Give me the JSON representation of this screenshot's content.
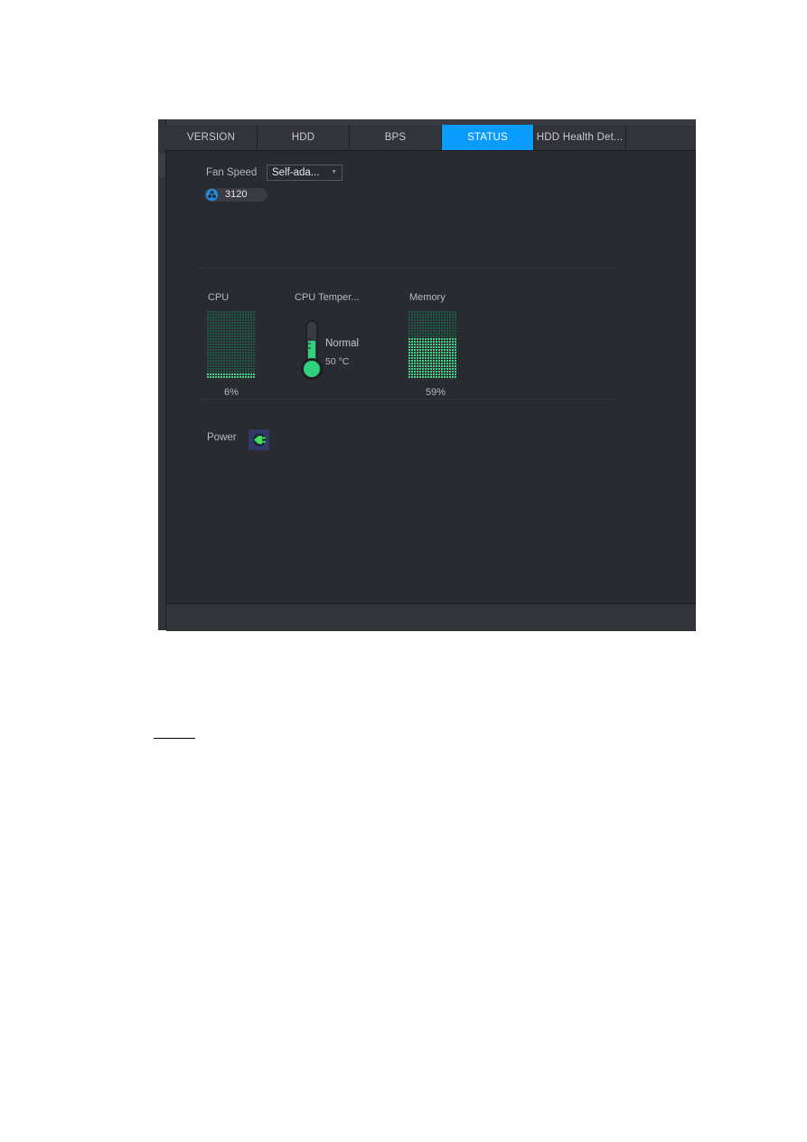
{
  "tabs": [
    {
      "label": "VERSION",
      "active": false
    },
    {
      "label": "HDD",
      "active": false
    },
    {
      "label": "BPS",
      "active": false
    },
    {
      "label": "STATUS",
      "active": true
    },
    {
      "label": "HDD Health Det...",
      "active": false
    }
  ],
  "fan": {
    "label": "Fan Speed",
    "mode_selected": "Self-ada...",
    "speed": "3120",
    "icon": "fan-icon"
  },
  "cpu": {
    "label": "CPU",
    "usage_percent": 6,
    "usage_text": "6%"
  },
  "cpu_temperature": {
    "label": "CPU Temper...",
    "status": "Normal",
    "value": "50 °C",
    "level_fraction": 0.6
  },
  "memory": {
    "label": "Memory",
    "usage_percent": 59,
    "usage_text": "59%"
  },
  "power": {
    "label": "Power",
    "icon": "power-plug-icon",
    "status_color": "#3fe05a"
  },
  "colors": {
    "accent": "#0a9bff",
    "bar_on": "#3fd38a",
    "bar_off": "#1f5a44",
    "thermo_fill": "#2fd27a"
  }
}
